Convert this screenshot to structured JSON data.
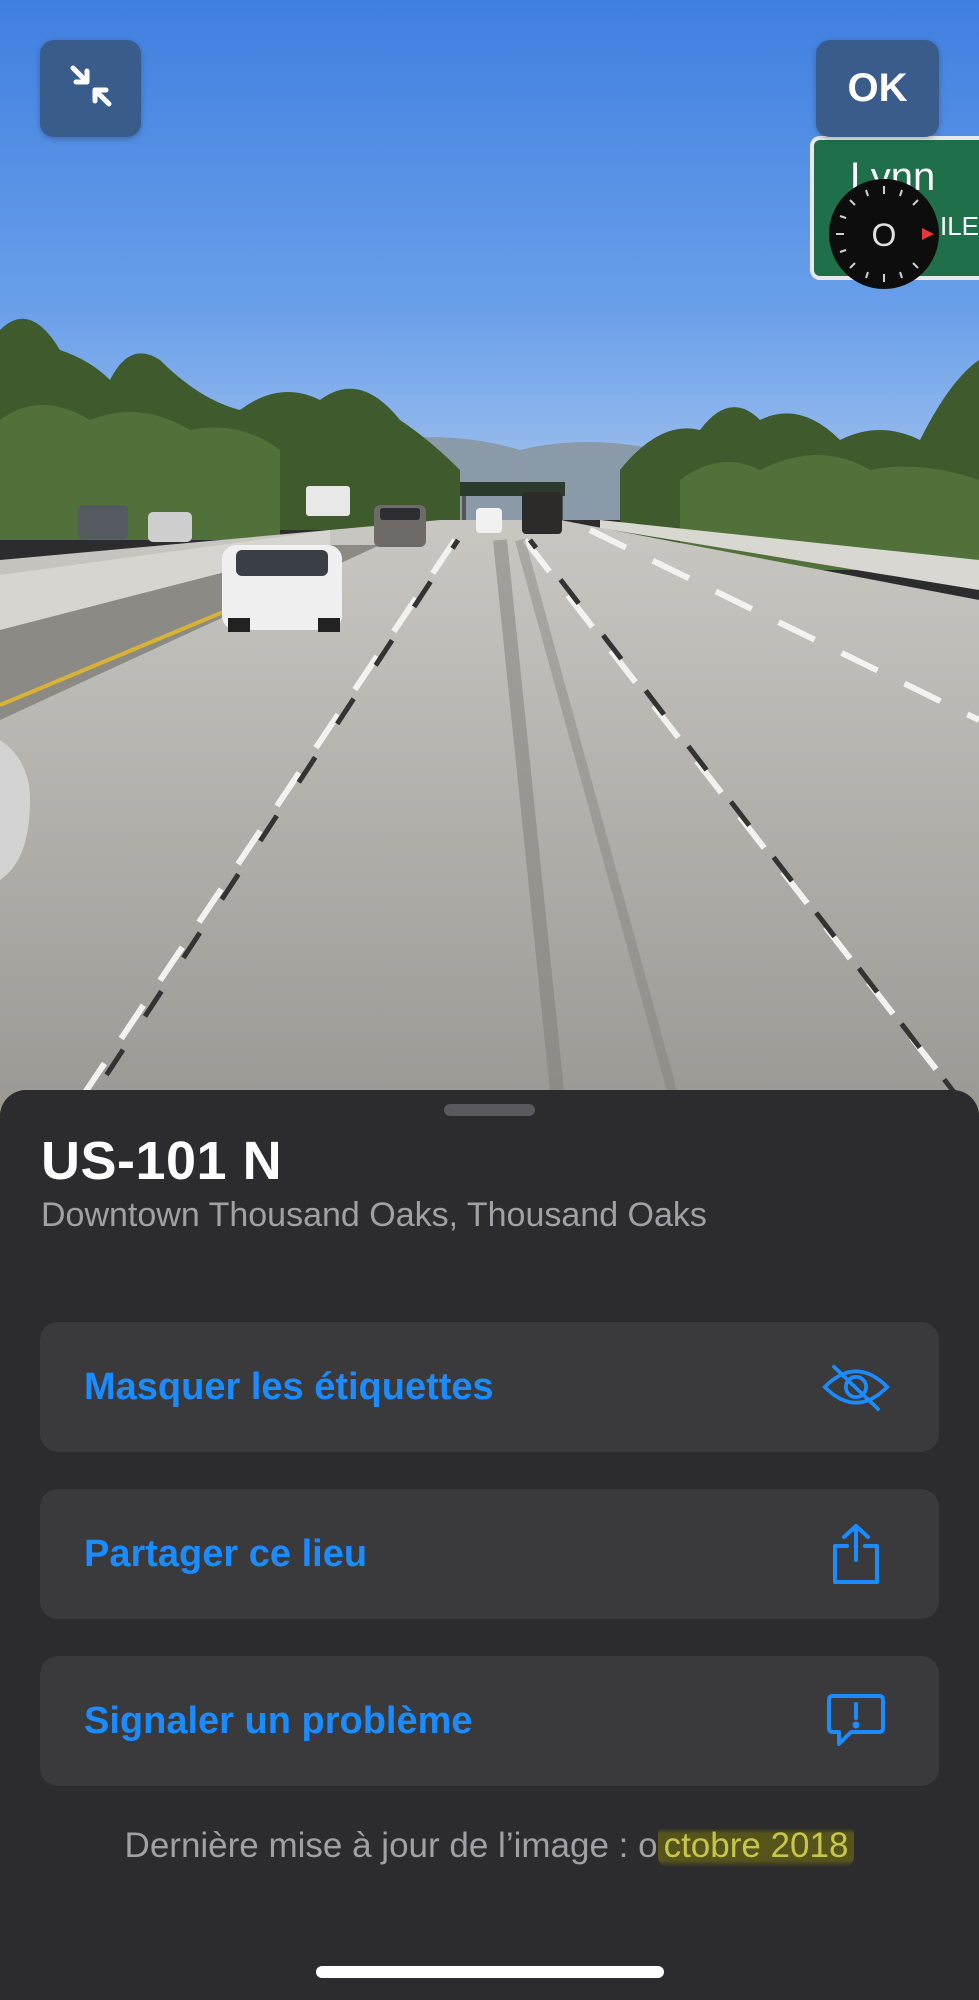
{
  "toolbar": {
    "ok_label": "OK",
    "collapse_icon": "collapse-arrows-icon"
  },
  "compass": {
    "label": "O",
    "icon": "compass-icon"
  },
  "sign": {
    "text_line1": "Lynn",
    "text_line2": "ILE"
  },
  "place": {
    "title": "US-101 N",
    "subtitle": "Downtown Thousand Oaks, Thousand Oaks"
  },
  "actions": [
    {
      "label": "Masquer les étiquettes",
      "icon": "eye-slash-icon"
    },
    {
      "label": "Partager ce lieu",
      "icon": "share-icon"
    },
    {
      "label": "Signaler un problème",
      "icon": "report-bubble-icon"
    }
  ],
  "footer": {
    "prefix": "Dernière mise à jour de l’image : o",
    "date": "ctobre 2018"
  },
  "colors": {
    "accent": "#1a8cff",
    "sheet_bg": "#2c2c2e",
    "row_bg": "#3a3a3c",
    "button_bg": "#3a5c8a",
    "highlight": "#55541a"
  }
}
